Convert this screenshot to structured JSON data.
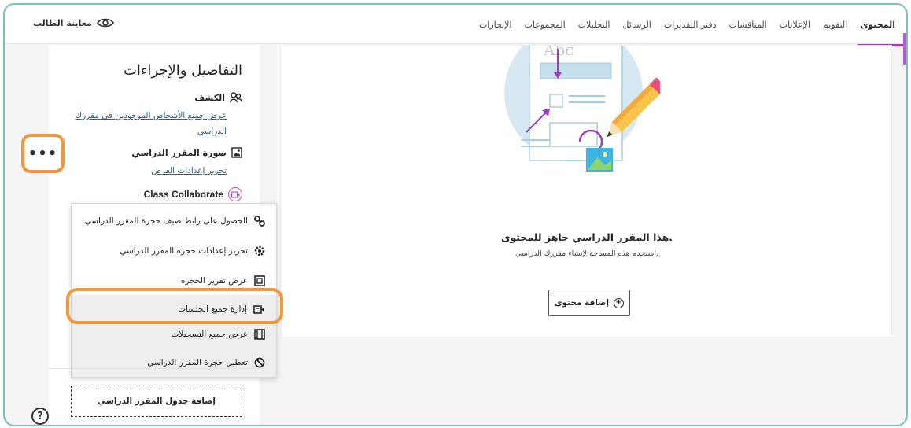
{
  "nav": {
    "tabs": [
      {
        "label": "المحتوى",
        "active": true
      },
      {
        "label": "التقويم"
      },
      {
        "label": "الإعلانات"
      },
      {
        "label": "المناقشات"
      },
      {
        "label": "دفتر التقديرات"
      },
      {
        "label": "الرسائل"
      },
      {
        "label": "التحليلات"
      },
      {
        "label": "المجموعات"
      },
      {
        "label": "الإنجازات"
      }
    ],
    "student_preview": "معاينة الطالب"
  },
  "details": {
    "title": "التفاصيل والإجراءات",
    "roster": {
      "label": "الكشف",
      "link": "عرض جميع الأشخاص الموجودين في مقررك الدراسي"
    },
    "banner": {
      "label": "صورة المقرر الدراسي",
      "link": "تحرير إعدادات العرض"
    },
    "collaborate": {
      "label": "Class Collaborate",
      "more_label": "•••"
    }
  },
  "menu": {
    "items": [
      {
        "label": "الحصول على رابط ضيف حجرة المقرر الدراسي",
        "icon": "link-icon"
      },
      {
        "label": "تحرير إعدادات حجرة المقرر الدراسي",
        "icon": "gear-icon"
      },
      {
        "label": "عرض تقرير الحجرة",
        "icon": "report-icon"
      },
      {
        "label": "إدارة جميع الجلسات",
        "icon": "video-icon"
      },
      {
        "label": "عرض جميع التسجيلات",
        "icon": "film-icon"
      },
      {
        "label": "تعطيل حجرة المقرر الدراسي",
        "icon": "disable-icon"
      }
    ]
  },
  "schedule_button": "إضافة جدول المقرر الدراسي",
  "help_label": "?",
  "content": {
    "empty_title": "هذا المقرر الدراسي جاهز للمحتوى.",
    "empty_subtitle": "استخدم هذه المساحة لإنشاء مقررك الدراسي.",
    "add_button": "إضافة محتوى",
    "art_text": "Abc"
  },
  "colors": {
    "accent_purple": "#9b3fbf",
    "highlight_orange": "#f6963a",
    "frame_teal": "#78c3bd",
    "link_blue": "#2b5d97"
  }
}
